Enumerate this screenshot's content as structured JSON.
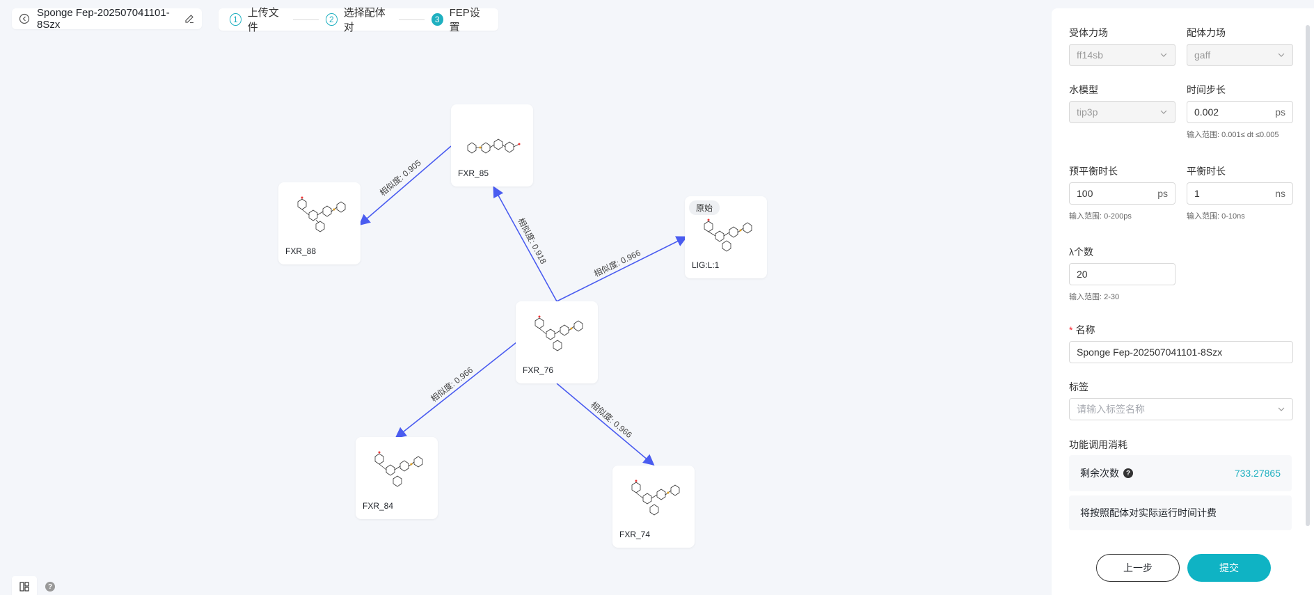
{
  "header": {
    "project_title": "Sponge Fep-202507041101-8Szx",
    "steps": [
      {
        "num": "1",
        "label": "上传文件"
      },
      {
        "num": "2",
        "label": "选择配体对"
      },
      {
        "num": "3",
        "label": "FEP设置"
      }
    ]
  },
  "graph": {
    "nodes": [
      {
        "id": "FXR_85",
        "label": "FXR_85"
      },
      {
        "id": "FXR_88",
        "label": "FXR_88"
      },
      {
        "id": "LIG",
        "label": "LIG:L:1",
        "tag": "原始"
      },
      {
        "id": "FXR_76",
        "label": "FXR_76"
      },
      {
        "id": "FXR_84",
        "label": "FXR_84"
      },
      {
        "id": "FXR_74",
        "label": "FXR_74"
      }
    ],
    "edges": [
      {
        "from": "FXR_85",
        "to": "FXR_88",
        "label": "相似度: 0.905"
      },
      {
        "from": "FXR_76",
        "to": "FXR_85",
        "label": "相似度: 0.918"
      },
      {
        "from": "FXR_76",
        "to": "LIG",
        "label": "相似度: 0.966"
      },
      {
        "from": "FXR_76",
        "to": "FXR_84",
        "label": "相似度: 0.966"
      },
      {
        "from": "FXR_76",
        "to": "FXR_74",
        "label": "相似度: 0.966"
      }
    ],
    "edge_color": "#4a5cf0"
  },
  "settings": {
    "receptor_ff": {
      "label": "受体力场",
      "value": "ff14sb"
    },
    "ligand_ff": {
      "label": "配体力场",
      "value": "gaff"
    },
    "water_model": {
      "label": "水模型",
      "value": "tip3p"
    },
    "timestep": {
      "label": "时间步长",
      "value": "0.002",
      "unit": "ps",
      "hint": "输入范围: 0.001≤ dt ≤0.005"
    },
    "pre_eq": {
      "label": "预平衡时长",
      "value": "100",
      "unit": "ps",
      "hint": "输入范围: 0-200ps"
    },
    "eq": {
      "label": "平衡时长",
      "value": "1",
      "unit": "ns",
      "hint": "输入范围: 0-10ns"
    },
    "lambda": {
      "label": "λ个数",
      "value": "20",
      "hint": "输入范围: 2-30"
    },
    "name": {
      "required": "*",
      "label": "名称",
      "value": "Sponge Fep-202507041101-8Szx"
    },
    "tags": {
      "label": "标签",
      "placeholder": "请输入标签名称"
    },
    "cost": {
      "title": "功能调用消耗",
      "remain_label": "剩余次数",
      "remain_value": "733.27865",
      "billing_note": "将按照配体对实际运行时间计费"
    },
    "buttons": {
      "prev": "上一步",
      "submit": "提交"
    }
  },
  "colors": {
    "accent": "#0fb3c4",
    "edge": "#4a5cf0"
  }
}
